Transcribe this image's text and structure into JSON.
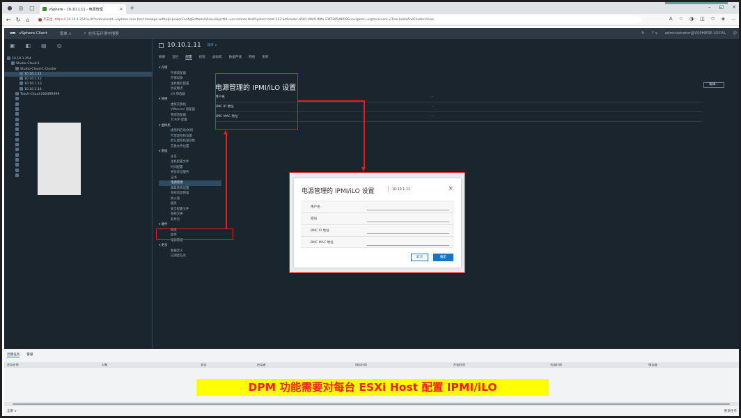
{
  "browser": {
    "tab_title": "vSphere - 10.10.1.11 - 电源管理",
    "omnibox_warning": "不安全",
    "omnibox_scheme": "https://",
    "omnibox_url": "10.10.1.254/ui/#?extensionId=vsphere.core.host.manage.settings.powerConfigSoftwareViewℴobjectId=urn:vmomi:HostSystem:host-212:ed6ceebc-d581-4845-99fa-23f7285d8f09&navigator=vsphere.core.viTree.hostsAndClustersView"
  },
  "vsphere": {
    "logo": "vm",
    "app_title": "vSphere Client",
    "menu_label": "菜单",
    "search_placeholder": "在所有环境中搜索",
    "user": "administrator@VSPHERE.LOCAL"
  },
  "inventory": [
    {
      "label": "10.10.1.254",
      "indent": 0,
      "sel": false
    },
    {
      "label": "Studio-Cloud-1",
      "indent": 1,
      "sel": false
    },
    {
      "label": "Studio-Cloud-1-Cluster",
      "indent": 2,
      "sel": false
    },
    {
      "label": "10.10.1.11",
      "indent": 3,
      "sel": true
    },
    {
      "label": "10.10.1.12",
      "indent": 3,
      "sel": false
    },
    {
      "label": "10.10.1.13",
      "indent": 3,
      "sel": false
    },
    {
      "label": "10.10.1.14",
      "indent": 3,
      "sel": false
    },
    {
      "label": "Teach-Cloud-2024RR999",
      "indent": 2,
      "sel": false
    },
    {
      "label": "",
      "indent": 2,
      "sel": false
    },
    {
      "label": "",
      "indent": 2,
      "sel": false
    },
    {
      "label": "",
      "indent": 2,
      "sel": false
    },
    {
      "label": "",
      "indent": 2,
      "sel": false
    },
    {
      "label": "",
      "indent": 2,
      "sel": false
    },
    {
      "label": "",
      "indent": 2,
      "sel": false
    },
    {
      "label": "",
      "indent": 2,
      "sel": false
    },
    {
      "label": "",
      "indent": 2,
      "sel": false
    },
    {
      "label": "",
      "indent": 2,
      "sel": false
    },
    {
      "label": "",
      "indent": 2,
      "sel": false
    },
    {
      "label": "",
      "indent": 2,
      "sel": false
    },
    {
      "label": "",
      "indent": 2,
      "sel": false
    },
    {
      "label": "",
      "indent": 2,
      "sel": false
    },
    {
      "label": "",
      "indent": 2,
      "sel": false
    },
    {
      "label": "",
      "indent": 2,
      "sel": false
    },
    {
      "label": "",
      "indent": 2,
      "sel": false
    }
  ],
  "host": {
    "name": "10.10.1.11",
    "actions": "操作 ∨",
    "tabs": [
      "摘要",
      "监控",
      "配置",
      "权限",
      "虚拟机",
      "数据存储",
      "网络",
      "更新"
    ],
    "active_tab": 2
  },
  "config_nav": [
    {
      "t": "存储",
      "g": true
    },
    {
      "t": "存储适配器"
    },
    {
      "t": "存储设备"
    },
    {
      "t": "主机缓存配置"
    },
    {
      "t": "协议端点"
    },
    {
      "t": "I/O 筛选器"
    },
    {
      "t": "网络",
      "g": true
    },
    {
      "t": "虚拟交换机"
    },
    {
      "t": "VMkernel 适配器"
    },
    {
      "t": "物理适配器"
    },
    {
      "t": "TCP/IP 配置"
    },
    {
      "t": "虚拟机",
      "g": true
    },
    {
      "t": "虚拟机启动/关机"
    },
    {
      "t": "代理虚拟机设置"
    },
    {
      "t": "默认虚拟机兼容性"
    },
    {
      "t": "交换文件位置"
    },
    {
      "t": "系统",
      "g": true
    },
    {
      "t": "许可"
    },
    {
      "t": "主机配置文件"
    },
    {
      "t": "时间配置"
    },
    {
      "t": "身份验证服务"
    },
    {
      "t": "证书"
    },
    {
      "t": "电源管理",
      "hl": true
    },
    {
      "t": "高级系统设置"
    },
    {
      "t": "系统资源预留"
    },
    {
      "t": "防火墙"
    },
    {
      "t": "服务"
    },
    {
      "t": "安全配置文件"
    },
    {
      "t": "系统交换"
    },
    {
      "t": "软件包"
    },
    {
      "t": "硬件",
      "g": true
    },
    {
      "t": "概览"
    },
    {
      "t": "固件"
    },
    {
      "t": "电源管理"
    },
    {
      "t": "更多",
      "g": true
    },
    {
      "t": "警报定义"
    },
    {
      "t": "已调度任务"
    }
  ],
  "pane": {
    "title": "电源管理的 IPMI/iLO 设置",
    "edit_label": "编辑...",
    "rows": [
      {
        "label": "用户名",
        "value": "--"
      },
      {
        "label": "BMC IP 地址",
        "value": "--"
      },
      {
        "label": "BMC MAC 地址",
        "value": "--"
      }
    ]
  },
  "dialog": {
    "title": "电源管理的 IPMI/iLO 设置",
    "host": "10.10.1.11",
    "close": "×",
    "fields": [
      "用户名",
      "密码",
      "BMC IP 地址",
      "BMC MAC 地址"
    ],
    "cancel": "取消",
    "ok": "确定"
  },
  "recent": {
    "tabs": [
      "近期任务",
      "警报"
    ],
    "columns": [
      "任务名称",
      "对象",
      "状态",
      "启动者",
      "排队时间",
      "开始时间",
      "完成时间",
      "服务器"
    ],
    "filter": "全部 ∨",
    "more": "更多任务"
  },
  "banner": "DPM 功能需要对每台 ESXi Host 配置 IPMI/iLO",
  "colors": {
    "callout": "#e0201b",
    "banner_bg": "#ffff00",
    "banner_text": "#ff1a1a"
  }
}
